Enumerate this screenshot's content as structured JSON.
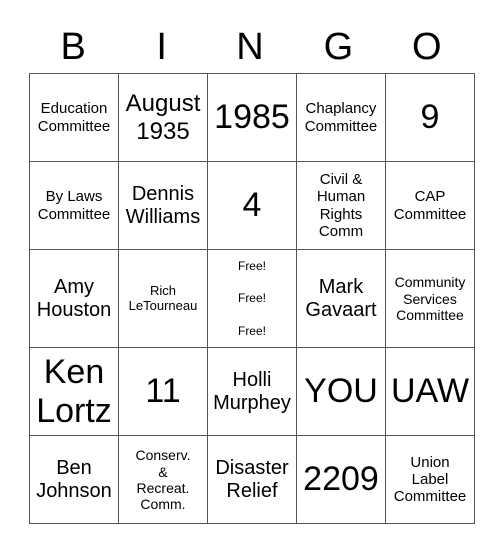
{
  "header": [
    "B",
    "I",
    "N",
    "G",
    "O"
  ],
  "rows": [
    [
      "Education\nCommittee",
      "August\n1935",
      "1985",
      "Chaplancy\nCommittee",
      "9"
    ],
    [
      "By Laws\nCommittee",
      "Dennis\nWilliams",
      "4",
      "Civil &\nHuman\nRights\nComm",
      "CAP\nCommittee"
    ],
    [
      "Amy\nHouston",
      "Rich\nLeTourneau",
      "Free!\nFree!\nFree!",
      "Mark\nGavaart",
      "Community\nServices\nCommittee"
    ],
    [
      "Ken\nLortz",
      "11",
      "Holli\nMurphey",
      "YOU",
      "UAW"
    ],
    [
      "Ben\nJohnson",
      "Conserv.\n&\nRecreat.\nComm.",
      "Disaster\nRelief",
      "2209",
      "Union\nLabel\nCommittee"
    ]
  ]
}
